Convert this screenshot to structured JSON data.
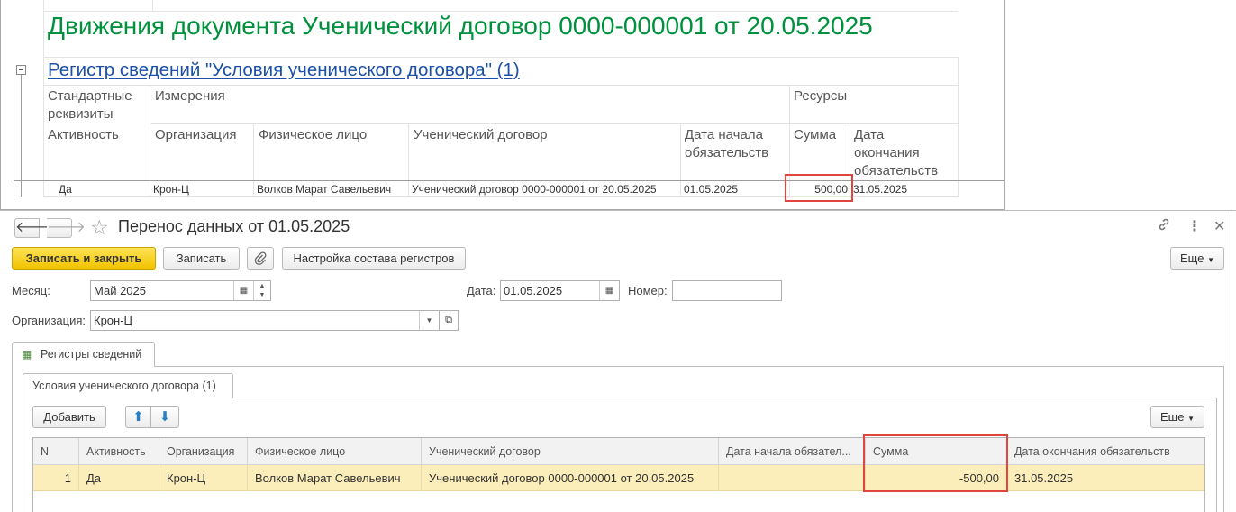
{
  "report": {
    "title": "Движения документа Ученический договор 0000-000001 от 20.05.2025",
    "register_link": "Регистр сведений \"Условия ученического договора\" (1)",
    "group_headers": {
      "standard_1": "Стандартные",
      "standard_2": "реквизиты",
      "dimensions": "Измерения",
      "resources": "Ресурсы"
    },
    "columns": {
      "activity": "Активность",
      "organization": "Организация",
      "person": "Физическое лицо",
      "contract": "Ученический договор",
      "start_date_1": "Дата начала",
      "start_date_2": "обязательств",
      "amount": "Сумма",
      "end_date_1": "Дата",
      "end_date_2": "окончания",
      "end_date_3": "обязательств"
    },
    "row": {
      "activity": "Да",
      "organization": "Крон-Ц",
      "person": "Волков Марат Савельевич",
      "contract": "Ученический договор 0000-000001 от 20.05.2025",
      "start_date": "01.05.2025",
      "amount": "500,00",
      "end_date": "31.05.2025"
    }
  },
  "form": {
    "title": "Перенос данных  от 01.05.2025",
    "toolbar": {
      "save_close": "Записать и закрыть",
      "save": "Записать",
      "attach_icon": "paperclip-icon",
      "registers": "Настройка состава регистров",
      "more": "Еще"
    },
    "fields": {
      "month_label": "Месяц:",
      "month_value": "Май 2025",
      "date_label": "Дата:",
      "date_value": "01.05.2025",
      "number_label": "Номер:",
      "number_value": "",
      "org_label": "Организация:",
      "org_value": "Крон-Ц"
    },
    "tab_outer": "Регистры сведений",
    "tab_inner": "Условия ученического договора (1)",
    "grid_toolbar": {
      "add": "Добавить",
      "more": "Еще"
    },
    "grid": {
      "columns": [
        "N",
        "Активность",
        "Организация",
        "Физическое лицо",
        "Ученический договор",
        "Дата начала обязател...",
        "Сумма",
        "Дата окончания обязательств"
      ],
      "rows": [
        {
          "n": "1",
          "activity": "Да",
          "organization": "Крон-Ц",
          "person": "Волков Марат Савельевич",
          "contract": "Ученический договор 0000-000001 от 20.05.2025",
          "start_date": "",
          "amount": "-500,00",
          "end_date": "31.05.2025"
        }
      ]
    },
    "colors": {
      "accent": "#f2c200",
      "title_green": "#00913d",
      "link_blue": "#1b4fa8",
      "highlight": "#e0453e",
      "row_selected": "#fbeebb"
    }
  }
}
